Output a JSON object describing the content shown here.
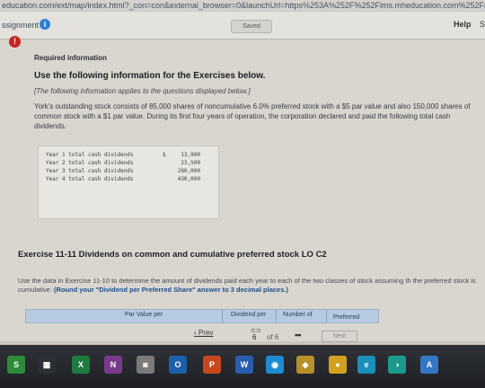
{
  "browser": {
    "url": "education.com/ext/map/index.html?_con=con&external_browser=0&launchUrl=https%253A%252F%252Flms.mheducation.com%252Fmghmiddleware"
  },
  "header": {
    "assignment_label": "ssignment",
    "saved_label": "Saved",
    "help_label": "Help",
    "extra_glyph": "S"
  },
  "content": {
    "required_info": "Required information",
    "instruction": "Use the following information for the Exercises below.",
    "instruction_note": "[The following information applies to the questions displayed below.]",
    "paragraph": "York's outstanding stock consists of 85,000 shares of noncumulative 6.0% preferred stock with a $5 par value and also 150,000 shares of common stock with a $1 par value. During its first four years of operation, the corporation declared and paid the following total cash dividends.",
    "dividends": [
      {
        "label": "Year 1 total cash dividends",
        "symbol": "$",
        "value": "13,900"
      },
      {
        "label": "Year 2 total cash dividends",
        "symbol": "",
        "value": "23,500"
      },
      {
        "label": "Year 3 total cash dividends",
        "symbol": "",
        "value": "280,000"
      },
      {
        "label": "Year 4 total cash dividends",
        "symbol": "",
        "value": "430,000"
      }
    ],
    "exercise_title": "Exercise 11-11 Dividends on common and cumulative preferred stock LO C2",
    "exercise_text": "Use the data in Exercise 11-10 to determine the amount of dividends paid each year to each of the two classes of stock assuming th the preferred stock is cumulative.",
    "exercise_bold": "(Round your \"Dividend per Preferred Share\" answer to 3 decimal places.)",
    "table_headers": [
      "Par Value per",
      "Dividend per",
      "Number of",
      "Preferred"
    ]
  },
  "pager": {
    "prev_label": "Prev",
    "current_page": "6",
    "of_label": "of 6",
    "next_label": "Next"
  },
  "taskbar": {
    "icons": [
      {
        "name": "s-app-icon",
        "glyph": "S",
        "color": "#2e8b3a"
      },
      {
        "name": "windows-icon",
        "glyph": "▦",
        "color": "#2c2f35"
      },
      {
        "name": "excel-icon",
        "glyph": "X",
        "color": "#1f7a3e"
      },
      {
        "name": "onenote-icon",
        "glyph": "N",
        "color": "#7a3a8c"
      },
      {
        "name": "photos-icon",
        "glyph": "◙",
        "color": "#7a7a7a"
      },
      {
        "name": "outlook-icon",
        "glyph": "O",
        "color": "#1d5fa8"
      },
      {
        "name": "powerpoint-icon",
        "glyph": "P",
        "color": "#c8471f"
      },
      {
        "name": "word-icon",
        "glyph": "W",
        "color": "#2a5db0"
      },
      {
        "name": "browser-icon",
        "glyph": "◉",
        "color": "#1f8bd2"
      },
      {
        "name": "gold-app-icon",
        "glyph": "◆",
        "color": "#b89028"
      },
      {
        "name": "chrome-icon",
        "glyph": "●",
        "color": "#d2a020"
      },
      {
        "name": "edge-icon",
        "glyph": "e",
        "color": "#1a8fb8"
      },
      {
        "name": "teal-app-icon",
        "glyph": "◑",
        "color": "#1b9a8a"
      },
      {
        "name": "autodesk-icon",
        "glyph": "A",
        "color": "#3576c4"
      }
    ]
  }
}
